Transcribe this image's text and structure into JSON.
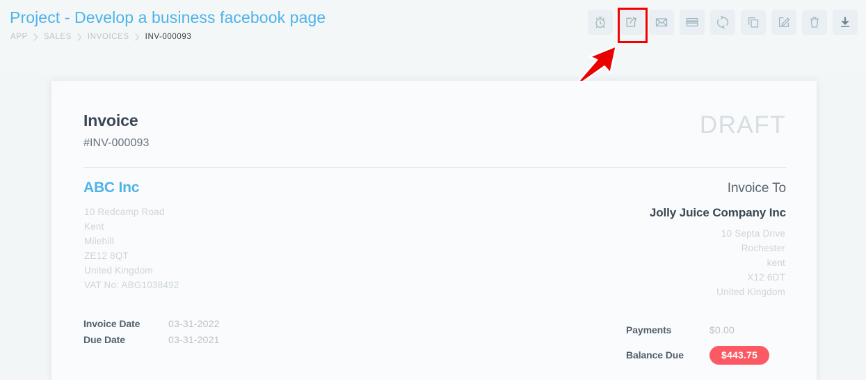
{
  "header": {
    "page_title": "Project - Develop a business facebook page",
    "breadcrumb": [
      {
        "label": "APP",
        "active": false
      },
      {
        "label": "SALES",
        "active": false
      },
      {
        "label": "INVOICES",
        "active": false
      },
      {
        "label": "INV-000093",
        "active": true
      }
    ],
    "toolbar": [
      {
        "name": "alarm-clock-icon",
        "label": "Reminder"
      },
      {
        "name": "share-icon",
        "label": "Publish Invoice"
      },
      {
        "name": "envelope-icon",
        "label": "Send Email"
      },
      {
        "name": "credit-card-icon",
        "label": "Record Payment"
      },
      {
        "name": "refresh-icon",
        "label": "Recurring"
      },
      {
        "name": "copy-icon",
        "label": "Duplicate"
      },
      {
        "name": "edit-icon",
        "label": "Edit"
      },
      {
        "name": "trash-icon",
        "label": "Delete"
      },
      {
        "name": "download-icon",
        "label": "Download"
      }
    ]
  },
  "annotation": {
    "label": "Publish Invoice",
    "color": "#f40000",
    "highlight_target": "share-icon"
  },
  "invoice": {
    "title": "Invoice",
    "number": "#INV-000093",
    "status_watermark": "DRAFT",
    "seller": {
      "name": "ABC Inc",
      "address_lines": [
        "10 Redcamp Road",
        "Kent",
        "Milehill",
        "ZE12 8QT",
        "United Kingdom",
        "VAT No: ABG1038492"
      ]
    },
    "buyer": {
      "heading": "Invoice To",
      "name": "Jolly Juice Company Inc",
      "address_lines": [
        "10 Septa Drive",
        "Rochester",
        "kent",
        "X12 6DT",
        "United Kingdom"
      ]
    },
    "dates": [
      {
        "label": "Invoice Date",
        "value": "03-31-2022"
      },
      {
        "label": "Due Date",
        "value": "03-31-2021"
      }
    ],
    "totals": [
      {
        "label": "Payments",
        "value": "$0.00",
        "badge": false
      },
      {
        "label": "Balance Due",
        "value": "$443.75",
        "badge": true
      }
    ]
  },
  "colors": {
    "accent_blue": "#4eb3e8",
    "page_background": "#f2f6f7",
    "card_background": "#fafbfc",
    "annotation_red": "#f40000",
    "balance_badge": "#fb5a64",
    "muted_text": "#ccd5da"
  }
}
